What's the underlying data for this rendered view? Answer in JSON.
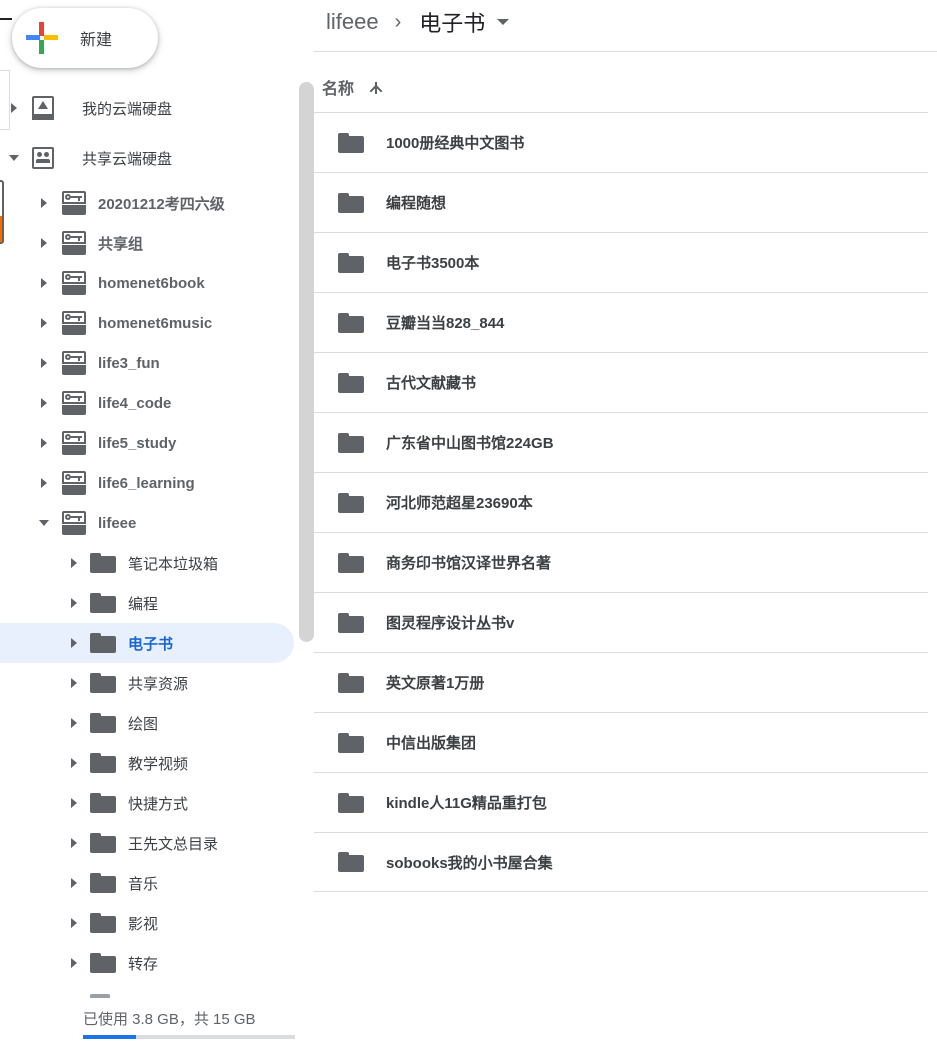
{
  "new_button": {
    "label": "新建"
  },
  "breadcrumb": {
    "root": "lifeee",
    "separator": "›",
    "current": "电子书"
  },
  "sidebar": {
    "my_drive": "我的云端硬盘",
    "shared_drives": "共享云端硬盘",
    "team_drives": [
      "20201212考四六级",
      "共享组",
      "homenet6book",
      "homenet6music",
      "life3_fun",
      "life4_code",
      "life5_study",
      "life6_learning",
      "lifeee"
    ],
    "lifeee_folders": [
      "笔记本垃圾箱",
      "编程",
      "电子书",
      "共享资源",
      "绘图",
      "教学视频",
      "快捷方式",
      "王先文总目录",
      "音乐",
      "影视",
      "转存"
    ],
    "selected": "电子书"
  },
  "storage": {
    "text": "已使用 3.8 GB，共 15 GB",
    "used_fraction": 0.25
  },
  "list": {
    "header_name": "名称",
    "sort": "ascending",
    "items": [
      "1000册经典中文图书",
      "编程随想",
      "电子书3500本",
      "豆瓣当当828_844",
      "古代文献藏书",
      "广东省中山图书馆224GB",
      "河北师范超星23690本",
      "商务印书馆汉译世界名著",
      "图灵程序设计丛书v",
      "英文原著1万册",
      "中信出版集团",
      "kindle人11G精品重打包",
      "sobooks我的小书屋合集"
    ]
  },
  "colors": {
    "accent": "#1a73e8",
    "selected_bg": "#e8f0fe",
    "selected_text": "#1967d2",
    "icon": "#5f6368"
  }
}
